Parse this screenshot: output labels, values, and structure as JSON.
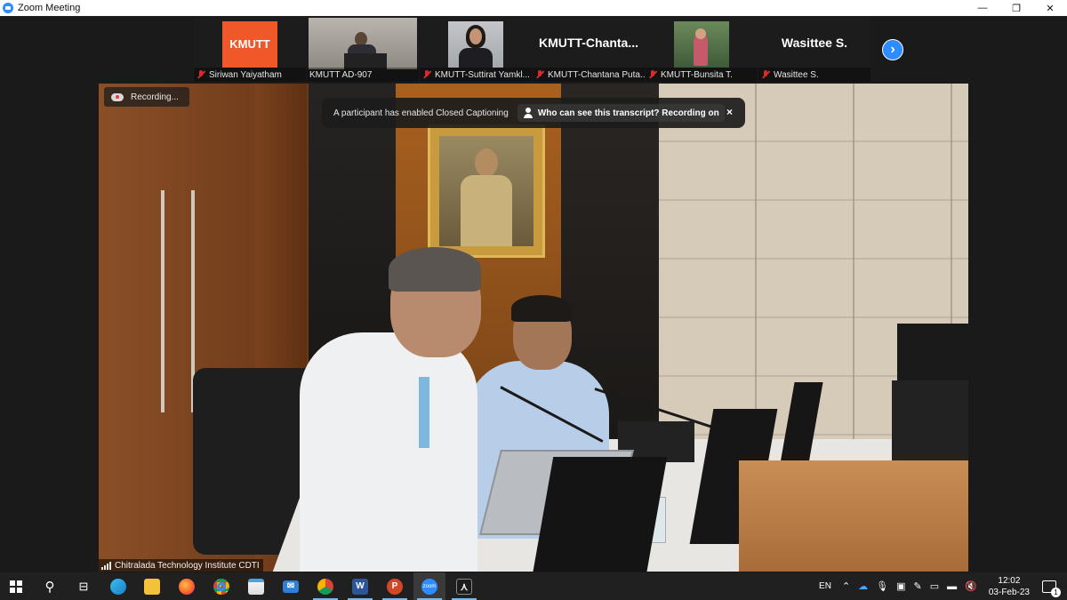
{
  "window": {
    "title": "Zoom Meeting",
    "controls": [
      "—",
      "❐",
      "✕"
    ]
  },
  "gallery": {
    "participants": [
      {
        "name": "Siriwan Yaiyatham",
        "muted": true,
        "video": "logo",
        "logo_text": "KMUTT"
      },
      {
        "name": "KMUTT AD-907",
        "muted": false,
        "video": "camera"
      },
      {
        "name": "KMUTT-Suttirat Yamkl...",
        "muted": true,
        "video": "camera"
      },
      {
        "name": "KMUTT-Chantana Puta...",
        "muted": true,
        "video": "name",
        "display_text": "KMUTT-Chanta..."
      },
      {
        "name": "KMUTT-Bunsita T.",
        "muted": true,
        "video": "camera"
      },
      {
        "name": "Wasittee S.",
        "muted": true,
        "video": "name",
        "display_text": "Wasittee S."
      }
    ],
    "next_icon": "chevron-right-icon"
  },
  "main_video": {
    "recording_label": "Recording...",
    "cc_banner": {
      "text": "A participant has enabled Closed Captioning",
      "link_label": "Who can see this transcript? Recording on",
      "close": "×"
    },
    "source_name": "Chitralada Technology Institute CDTI"
  },
  "taskbar": {
    "apps": [
      "start",
      "search",
      "task-view",
      "edge",
      "file-explorer",
      "firefox",
      "chrome",
      "store",
      "mail",
      "chrome-profile",
      "word",
      "powerpoint",
      "zoom",
      "acrobat"
    ],
    "app_letters": {
      "word": "W",
      "powerpoint": "P",
      "zoom": "zoom"
    },
    "tray": {
      "language": "EN",
      "time": "12:02",
      "date": "03-Feb-23",
      "notification_count": "1"
    }
  },
  "colors": {
    "zoom_blue": "#2d8cff",
    "mute_red": "#e02828",
    "kmutt_orange": "#f0582a",
    "taskbar": "#202020"
  }
}
